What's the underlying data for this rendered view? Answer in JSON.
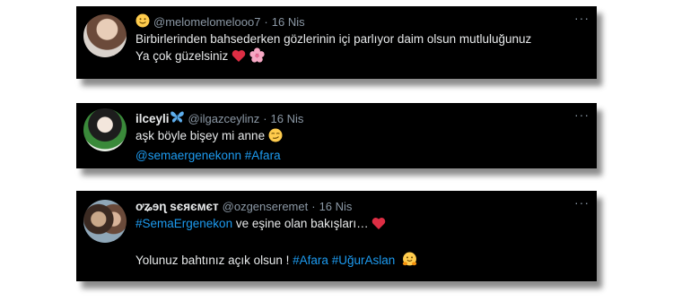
{
  "tweets": [
    {
      "display_name": "",
      "handle": "@melomelomelooo7",
      "separator": "·",
      "date": "16 Nis",
      "text_1": "Birbirlerinden bahsederken gözlerinin içi parlıyor daim olsun mutluluğunuz",
      "text_2": "Ya çok güzelsiniz",
      "header_icon": "smiling-face-icon",
      "trailing_icons": [
        "red-heart-icon",
        "cherry-blossom-icon"
      ]
    },
    {
      "display_name": "ilceyli",
      "handle": "@ilgazceylinz",
      "separator": "·",
      "date": "16 Nis",
      "text_1": "aşk böyle bişey mi anne",
      "mention": "@semaergenekonn",
      "hashtag": "#Afara",
      "name_icon": "blue-butterfly-icon",
      "trailing_icons": [
        "smirking-face-icon"
      ]
    },
    {
      "display_name": "ơʑɘɳ ѕєяємєт",
      "handle": "@ozgenseremet",
      "separator": "·",
      "date": "16 Nis",
      "hashtag_1": "#SemaErgenekon",
      "text_1": "ve eşine olan bakışları…",
      "text_2": "Yolunuz bahtınız açık olsun !",
      "hashtag_2": "#Afara",
      "hashtag_3": "#UğurAslan",
      "trailing_icons": [
        "red-heart-icon",
        "hugging-face-icon"
      ]
    }
  ],
  "more_label": "···",
  "colors": {
    "tweet_bg": "#000000",
    "text": "#e7e9ea",
    "muted": "#8b98a5",
    "link": "#1d9bf0",
    "heart": "#e0245e"
  }
}
